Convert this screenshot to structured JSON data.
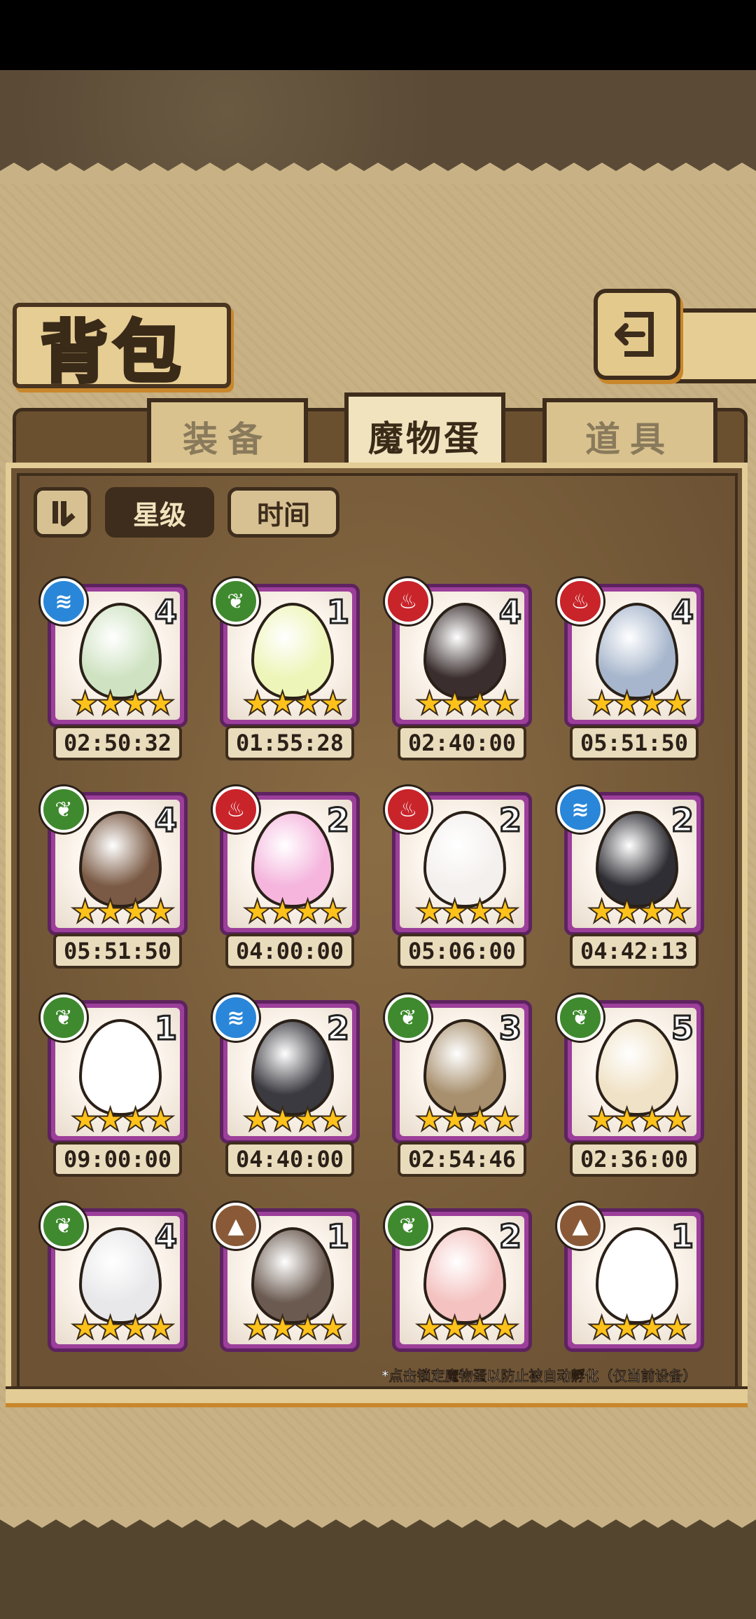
{
  "header": {
    "title": "背包",
    "back_icon": "back-arrow-icon"
  },
  "tabs": [
    {
      "label": "装备",
      "active": false
    },
    {
      "label": "魔物蛋",
      "active": true
    },
    {
      "label": "道具",
      "active": false
    }
  ],
  "sort": {
    "order_icon": "sort-order-icon",
    "star_label": "星级",
    "time_label": "时间",
    "selected": "星级"
  },
  "elements": {
    "water": {
      "color": "#2a86d8",
      "icon": "water-waves-icon"
    },
    "grass": {
      "color": "#3f8a2e",
      "icon": "leaf-icon"
    },
    "fire": {
      "color": "#c8242a",
      "icon": "flame-icon"
    },
    "earth": {
      "color": "#8a5a38",
      "icon": "mountain-icon"
    }
  },
  "eggs": [
    {
      "element": "water",
      "count": "4",
      "stars": 4,
      "timer": "02:50:32",
      "egg_color": "#cfe3c2"
    },
    {
      "element": "grass",
      "count": "1",
      "stars": 4,
      "timer": "01:55:28",
      "egg_color": "#eef5b8"
    },
    {
      "element": "fire",
      "count": "4",
      "stars": 4,
      "timer": "02:40:00",
      "egg_color": "#3a2e2e"
    },
    {
      "element": "fire",
      "count": "4",
      "stars": 4,
      "timer": "05:51:50",
      "egg_color": "#a7b6cc"
    },
    {
      "element": "grass",
      "count": "4",
      "stars": 4,
      "timer": "05:51:50",
      "egg_color": "#7a5a44"
    },
    {
      "element": "fire",
      "count": "2",
      "stars": 4,
      "timer": "04:00:00",
      "egg_color": "#f5b5dd"
    },
    {
      "element": "fire",
      "count": "2",
      "stars": 4,
      "timer": "05:06:00",
      "egg_color": "#f4f0ee"
    },
    {
      "element": "water",
      "count": "2",
      "stars": 4,
      "timer": "04:42:13",
      "egg_color": "#2e2e34"
    },
    {
      "element": "grass",
      "count": "1",
      "stars": 4,
      "timer": "09:00:00",
      "egg_color": "#ffffff"
    },
    {
      "element": "water",
      "count": "2",
      "stars": 4,
      "timer": "04:40:00",
      "egg_color": "#3a3a40"
    },
    {
      "element": "grass",
      "count": "3",
      "stars": 4,
      "timer": "02:54:46",
      "egg_color": "#a8906e"
    },
    {
      "element": "grass",
      "count": "5",
      "stars": 4,
      "timer": "02:36:00",
      "egg_color": "#f0e2c6"
    },
    {
      "element": "grass",
      "count": "4",
      "stars": 4,
      "timer": "",
      "egg_color": "#e8e8ea"
    },
    {
      "element": "earth",
      "count": "1",
      "stars": 4,
      "timer": "",
      "egg_color": "#6a5a50"
    },
    {
      "element": "grass",
      "count": "2",
      "stars": 4,
      "timer": "",
      "egg_color": "#f4c2c0"
    },
    {
      "element": "earth",
      "count": "1",
      "stars": 4,
      "timer": "",
      "egg_color": "#ffffff"
    }
  ],
  "footnote": "*点击锁定魔物蛋以防止被自动孵化（仅当前设备）"
}
